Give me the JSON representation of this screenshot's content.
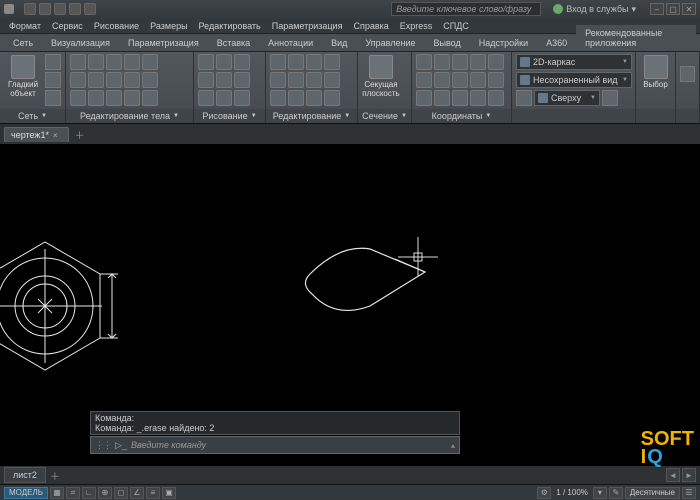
{
  "title_search_placeholder": "Введите ключевое слово/фразу",
  "signin_label": "Вход в службы",
  "menu": [
    "Сеть",
    "Визуализация",
    "Параметризация",
    "Вставка",
    "Аннотации",
    "Вид",
    "Управление",
    "Вывод",
    "Надстройки",
    "A360",
    "Рекомендованные приложения"
  ],
  "topmenu": [
    "Формат",
    "Сервис",
    "Рисование",
    "Размеры",
    "Редактировать",
    "Параметризация",
    "Справка",
    "Express",
    "СПДС"
  ],
  "panels": {
    "p1": {
      "label": "Сеть",
      "big": "Гладкий объект"
    },
    "p2": {
      "label": "Редактирование тела"
    },
    "p3": {
      "label": "Рисование"
    },
    "p4": {
      "label": "Редактирование"
    },
    "p5": {
      "label": "Сечение",
      "big": "Секущая плоскость"
    },
    "p6": {
      "label": "Координаты"
    },
    "p7": {
      "combo1": "2D-каркас",
      "combo2": "Несохраненный вид",
      "combo3": "Сверху"
    },
    "p8": {
      "big": "Выбор"
    }
  },
  "tabs": {
    "drawing": "чертеж1*"
  },
  "cmd": {
    "hist1": "Команда:",
    "hist2": "Команда: _.erase найдено: 2",
    "placeholder": "Введите команду"
  },
  "spacetab": "лист2",
  "status": {
    "model": "МОДЕЛЬ",
    "zoom": "1 / 100%",
    "units": "Десятичные"
  },
  "watermark": {
    "l1": "SOFT",
    "l2a": "I",
    "l2b": "Q"
  }
}
